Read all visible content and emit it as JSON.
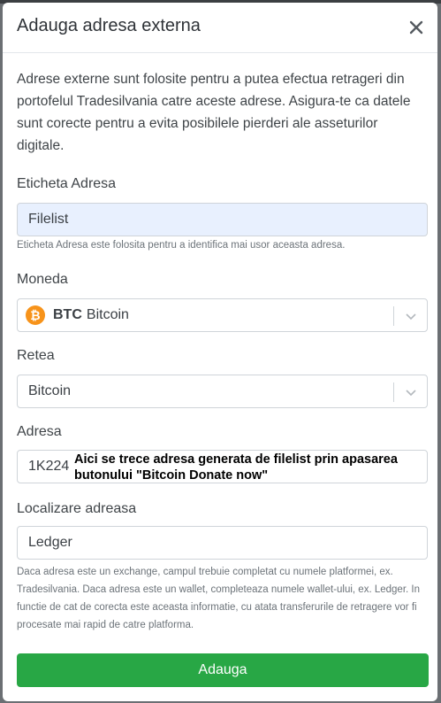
{
  "modal": {
    "title": "Adauga adresa externa",
    "intro": "Adrese externe sunt folosite pentru a putea efectua retrageri din portofelul Tradesilvania catre aceste adrese. Asigura-te ca datele sunt corecte pentru a evita posibilele pierderi ale asseturilor digitale."
  },
  "label_field": {
    "label": "Eticheta Adresa",
    "value": "Filelist",
    "help": "Eticheta Adresa este folosita pentru a identifica mai usor aceasta adresa."
  },
  "currency_field": {
    "label": "Moneda",
    "symbol": "BTC",
    "name": "Bitcoin",
    "icon": "bitcoin-icon",
    "icon_glyph": "₿"
  },
  "network_field": {
    "label": "Retea",
    "value": "Bitcoin"
  },
  "address_field": {
    "label": "Adresa",
    "value": "1K224",
    "annotation": "Aici se trece adresa generata de filelist prin apasarea butonului \"Bitcoin Donate now\""
  },
  "location_field": {
    "label": "Localizare adreasa",
    "value": "Ledger",
    "help": "Daca adresa este un exchange, campul trebuie completat cu numele platformei, ex. Tradesilvania. Daca adresa este un wallet, completeaza numele wallet-ului, ex. Ledger. In functie de cat de corecta este aceasta informatie, cu atata transferurile de retragere vor fi procesate mai rapid de catre platforma."
  },
  "submit_label": "Adauga",
  "colors": {
    "primary_button": "#28a745",
    "bitcoin": "#f7931a",
    "autofill_bg": "#e8f0fe"
  }
}
